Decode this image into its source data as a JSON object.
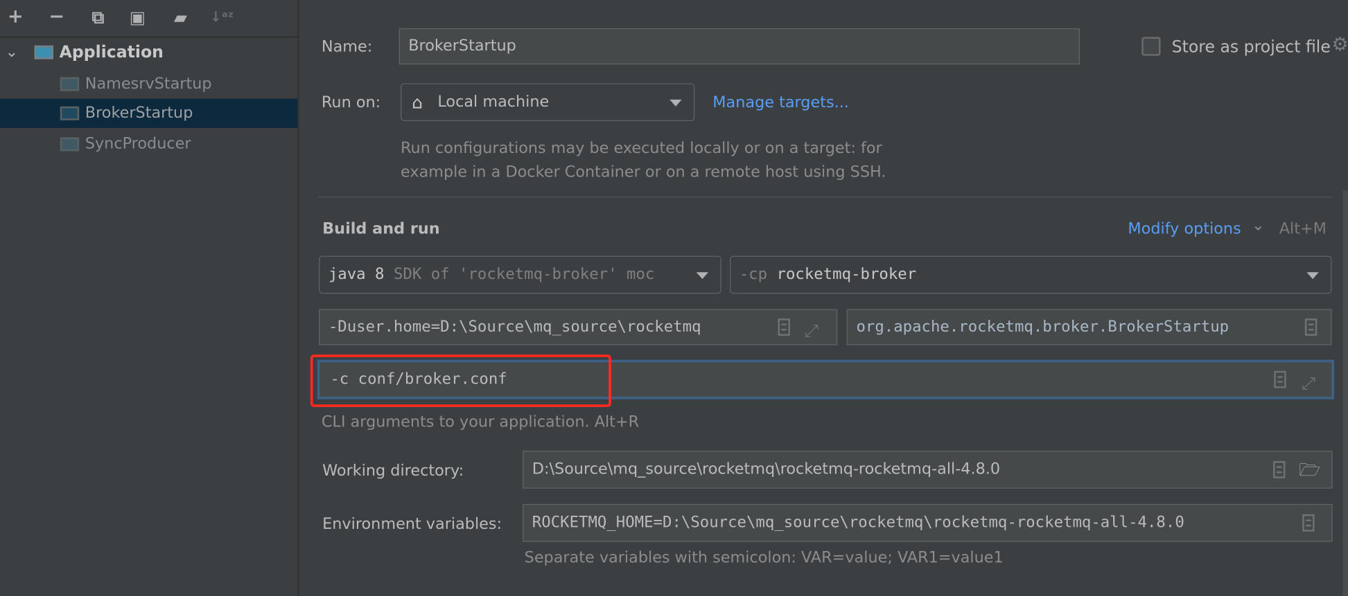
{
  "toolbar": {
    "icons": [
      "add-icon",
      "remove-icon",
      "copy-icon",
      "save-icon",
      "new-folder-icon",
      "sort-alpha-icon"
    ]
  },
  "tree": {
    "group": "Application",
    "items": [
      {
        "label": "NamesrvStartup",
        "selected": false
      },
      {
        "label": "BrokerStartup",
        "selected": true
      },
      {
        "label": "SyncProducer",
        "selected": false
      }
    ]
  },
  "form": {
    "name_label": "Name:",
    "name_value": "BrokerStartup",
    "store_label": "Store as project file",
    "store_checked": false,
    "run_on_label": "Run on:",
    "run_on_value": "Local machine",
    "manage_targets": "Manage targets...",
    "run_on_hint_1": "Run configurations may be executed locally or on a target: for",
    "run_on_hint_2": "example in a Docker Container or on a remote host using SSH.",
    "section_title": "Build and run",
    "modify_options": "Modify options",
    "modify_shortcut": "Alt+M",
    "jre_main": "java 8",
    "jre_hint": "SDK of 'rocketmq-broker' moc",
    "cp_prefix": "-cp",
    "cp_value": "rocketmq-broker",
    "vm_options": "-Duser.home=D:\\Source\\mq_source\\rocketmq",
    "main_class": "org.apache.rocketmq.broker.BrokerStartup",
    "program_args": "-c conf/broker.conf",
    "program_args_hint": "CLI arguments to your application. Alt+R",
    "workdir_label": "Working directory:",
    "workdir_value": "D:\\Source\\mq_source\\rocketmq\\rocketmq-rocketmq-all-4.8.0",
    "env_label": "Environment variables:",
    "env_value": "ROCKETMQ_HOME=D:\\Source\\mq_source\\rocketmq\\rocketmq-rocketmq-all-4.8.0",
    "env_hint": "Separate variables with semicolon: VAR=value; VAR1=value1"
  },
  "colors": {
    "accent_link": "#589df6",
    "selection": "#0d293e",
    "focus_border": "#3d6185",
    "highlight_box": "#ff2a1f"
  }
}
